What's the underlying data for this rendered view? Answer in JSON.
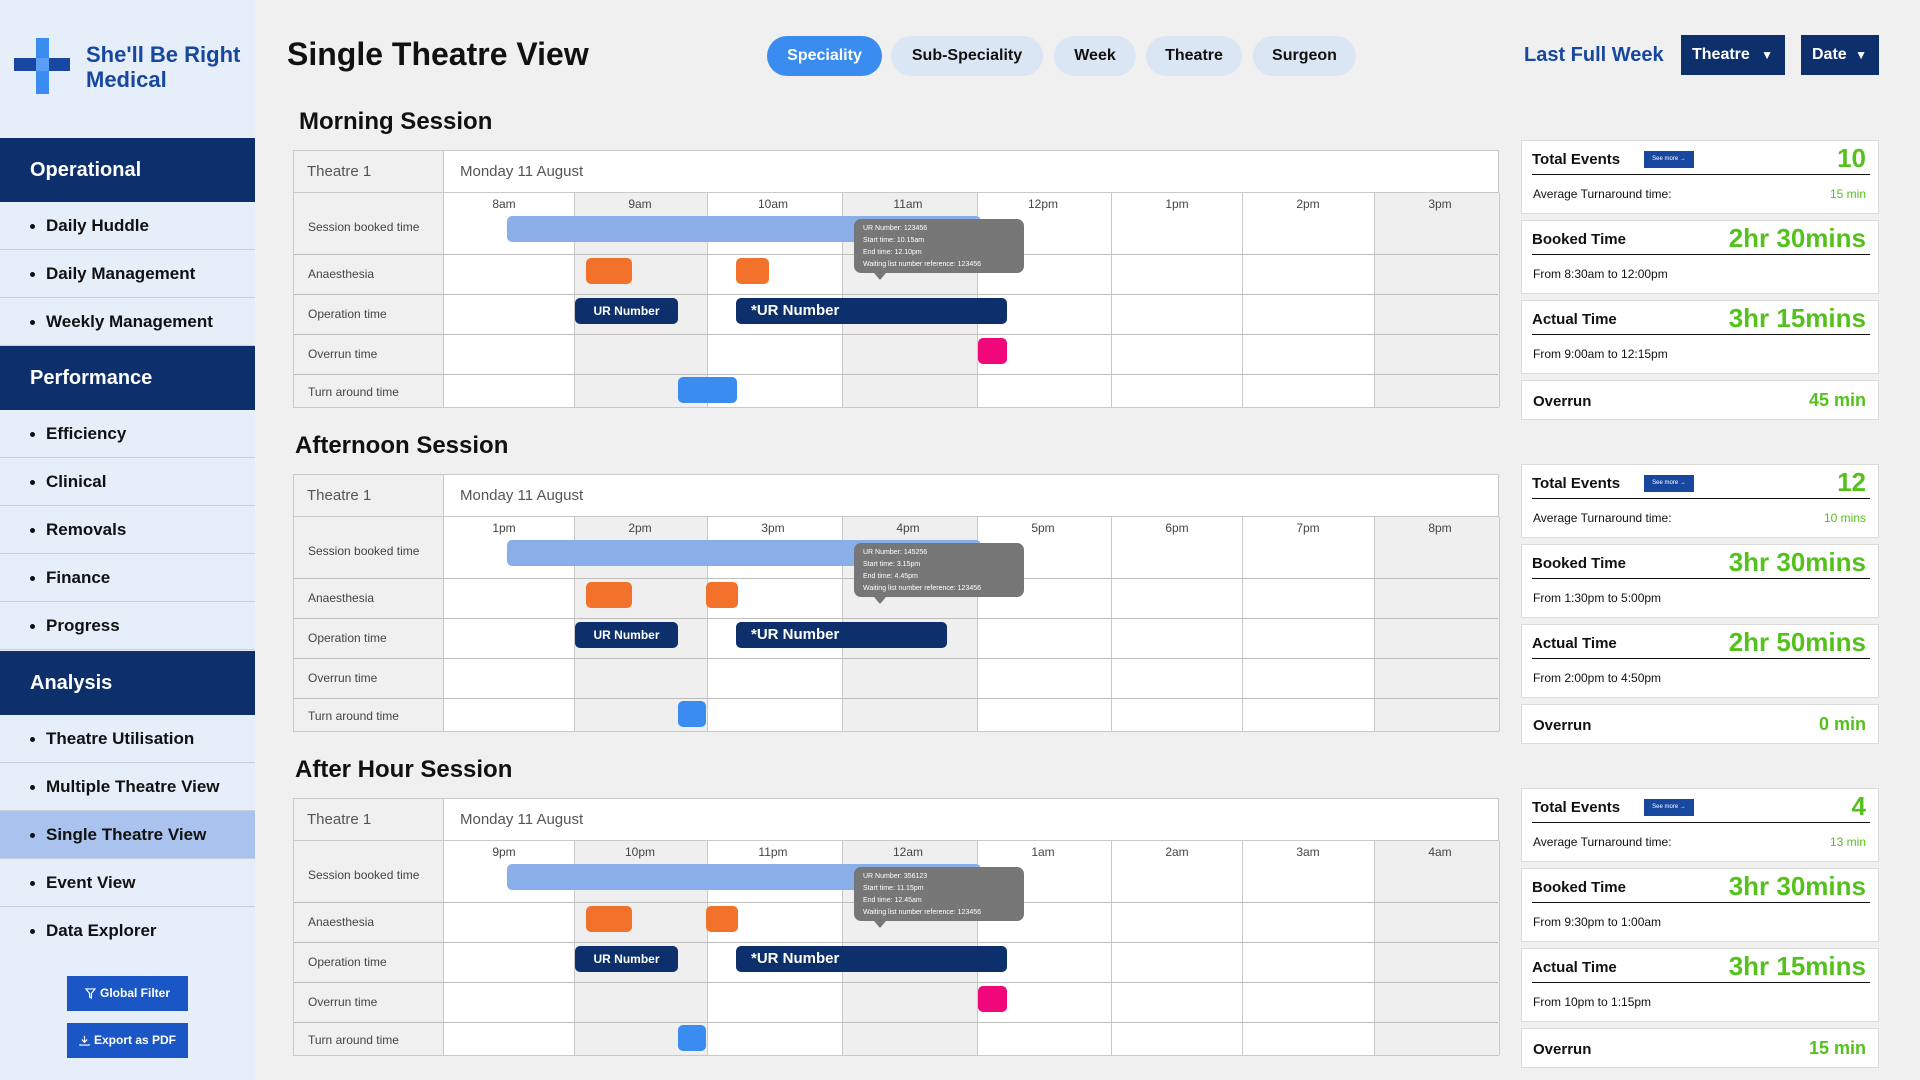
{
  "brand": {
    "name_line1": "She'll Be Right",
    "name_line2": "Medical"
  },
  "header": {
    "title": "Single Theatre View",
    "pills": [
      "Speciality",
      "Sub-Speciality",
      "Week",
      "Theatre",
      "Surgeon"
    ],
    "active_pill": "Speciality",
    "period_label": "Last Full Week",
    "dropdown_theatre": "Theatre",
    "dropdown_date": "Date"
  },
  "sidebar": {
    "sections": [
      {
        "label": "Operational",
        "items": [
          "Daily Huddle",
          "Daily Management",
          "Weekly Management"
        ]
      },
      {
        "label": "Performance",
        "items": [
          "Efficiency",
          "Clinical",
          "Removals",
          "Finance",
          "Progress"
        ]
      },
      {
        "label": "Analysis",
        "items": [
          "Theatre Utilisation",
          "Multiple Theatre View",
          "Single Theatre View",
          "Event View",
          "Data Explorer"
        ]
      }
    ],
    "active_item": "Single Theatre View",
    "global_filter": "Global Filter",
    "export_pdf": "Export as PDF"
  },
  "row_labels": [
    "Session booked time",
    "Anaesthesia",
    "Operation time",
    "Overrun time",
    "Turn around time"
  ],
  "sessions": [
    {
      "title": "Morning Session",
      "theatre": "Theatre 1",
      "date": "Monday 11 August",
      "hours": [
        "8am",
        "9am",
        "10am",
        "11am",
        "12pm",
        "1pm",
        "2pm",
        "3pm"
      ],
      "op_label_1": "UR Number",
      "op_label_2": "*UR Number",
      "tooltip": {
        "ur": "UR Number: 123456",
        "start": "Start time: 10.15am",
        "end": "End time: 12.10pm",
        "ref": "Waiting list number reference: 123456"
      },
      "stats": {
        "total_events_label": "Total Events",
        "total_events": "10",
        "see_more": "See more →",
        "avg_turnaround_label": "Average Turnaround time:",
        "avg_turnaround": "15 min",
        "booked_label": "Booked Time",
        "booked": "2hr 30mins",
        "booked_range": "From 8:30am to 12:00pm",
        "actual_label": "Actual Time",
        "actual": "3hr 15mins",
        "actual_range": "From 9:00am to 12:15pm",
        "overrun_label": "Overrun",
        "overrun": "45 min"
      }
    },
    {
      "title": "Afternoon Session",
      "theatre": "Theatre 1",
      "date": "Monday 11 August",
      "hours": [
        "1pm",
        "2pm",
        "3pm",
        "4pm",
        "5pm",
        "6pm",
        "7pm",
        "8pm"
      ],
      "op_label_1": "UR Number",
      "op_label_2": "*UR Number",
      "tooltip": {
        "ur": "UR Number: 145256",
        "start": "Start time: 3.15pm",
        "end": "End time: 4.45pm",
        "ref": "Waiting list number reference: 123456"
      },
      "stats": {
        "total_events_label": "Total Events",
        "total_events": "12",
        "see_more": "See more →",
        "avg_turnaround_label": "Average Turnaround time:",
        "avg_turnaround": "10 mins",
        "booked_label": "Booked Time",
        "booked": "3hr 30mins",
        "booked_range": "From 1:30pm to 5:00pm",
        "actual_label": "Actual Time",
        "actual": "2hr 50mins",
        "actual_range": "From 2:00pm to 4:50pm",
        "overrun_label": "Overrun",
        "overrun": "0 min"
      }
    },
    {
      "title": "After Hour Session",
      "theatre": "Theatre 1",
      "date": "Monday 11 August",
      "hours": [
        "9pm",
        "10pm",
        "11pm",
        "12am",
        "1am",
        "2am",
        "3am",
        "4am"
      ],
      "op_label_1": "UR Number",
      "op_label_2": "*UR Number",
      "tooltip": {
        "ur": "UR Number: 356123",
        "start": "Start time: 11.15pm",
        "end": "End time: 12.45am",
        "ref": "Waiting list number reference: 123456"
      },
      "stats": {
        "total_events_label": "Total Events",
        "total_events": "4",
        "see_more": "See more →",
        "avg_turnaround_label": "Average Turnaround time:",
        "avg_turnaround": "13 min",
        "booked_label": "Booked Time",
        "booked": "3hr 30mins",
        "booked_range": "From 9:30pm to 1:00am",
        "actual_label": "Actual Time",
        "actual": "3hr 15mins",
        "actual_range": "From 10pm to 1:15pm",
        "overrun_label": "Overrun",
        "overrun": "15 min"
      }
    }
  ],
  "colors": {
    "navy": "#0d2f6b",
    "accent_blue": "#3a8cf0",
    "session_bar": "#8aaee8",
    "anaesthesia": "#f2722b",
    "overrun": "#f0077a",
    "stat_green": "#55c11d"
  }
}
